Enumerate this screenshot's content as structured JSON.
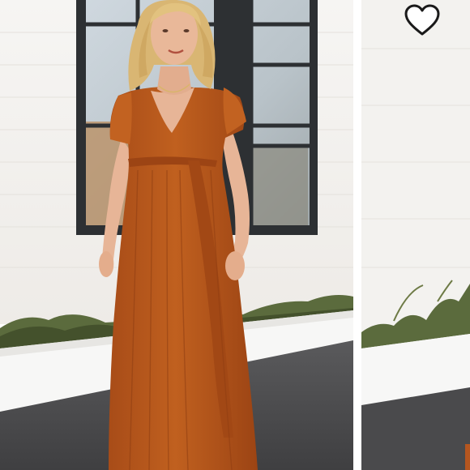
{
  "listing": {
    "photos": [
      {
        "icon": "photo-model-orange-maxi-dress"
      },
      {
        "icon": "photo-model-orange-maxi-dress-partial"
      }
    ],
    "favorite": {
      "icon": "heart-outline-icon",
      "active": false
    }
  },
  "colors": {
    "wall": "#f3f1ee",
    "dress": "#b5561f",
    "pavement": "#4a4a4c",
    "heart": "#1a1a1a"
  }
}
